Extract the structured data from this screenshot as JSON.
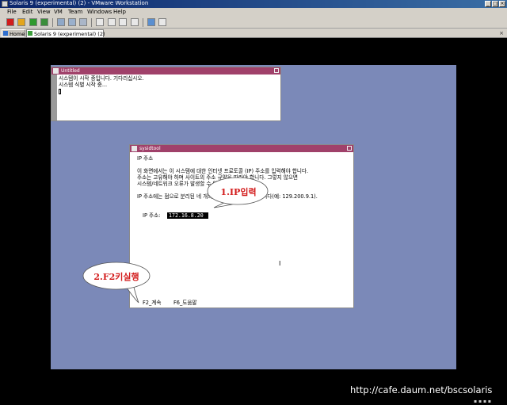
{
  "window": {
    "title": "Solaris 9 (experimental) (2) - VMware Workstation"
  },
  "menu": [
    "File",
    "Edit",
    "View",
    "VM",
    "Team",
    "Windows",
    "Help"
  ],
  "tabs": [
    {
      "label": "Home"
    },
    {
      "label": "Solaris 9 (experimental) (2)"
    }
  ],
  "guest": {
    "untitled_window": {
      "title": "Untitled",
      "lines": [
        "시스템이 시작 중입니다. 기다리십시오.",
        "시스템 식별 시작 중..."
      ]
    },
    "sysidtool_window": {
      "title": "sysidtool",
      "heading": "IP 주소",
      "para1": [
        "이 화면에서는 이 시스템에 대한 인터넷 프로토콜 (IP) 주소를 입력해야 합니다.",
        "주소는 고유해야 하며 사이트의 주소 규약을 따라야 합니다. 그렇지 않으면",
        "시스템/네트워크 오류가 발생할 수 있습니다."
      ],
      "para2": "IP 주소에는 점으로 분리된 네 개의 숫자가 들어 있어야 합니다(예: 129.200.9.1).",
      "ip_label": "IP 주소:",
      "ip_value": "172.16.8.208",
      "footer_f2": "F2_계속",
      "footer_f6": "F6_도움말"
    }
  },
  "annotations": {
    "ip_callout": "1.IP입력",
    "f2_callout": "2.F2키실행"
  },
  "watermark": "http://cafe.daum.net/bscsolaris",
  "colors": {
    "desktop": "#7b89b8",
    "window_titlebar": "#a0416a",
    "callout_text": "#d31d1d"
  }
}
